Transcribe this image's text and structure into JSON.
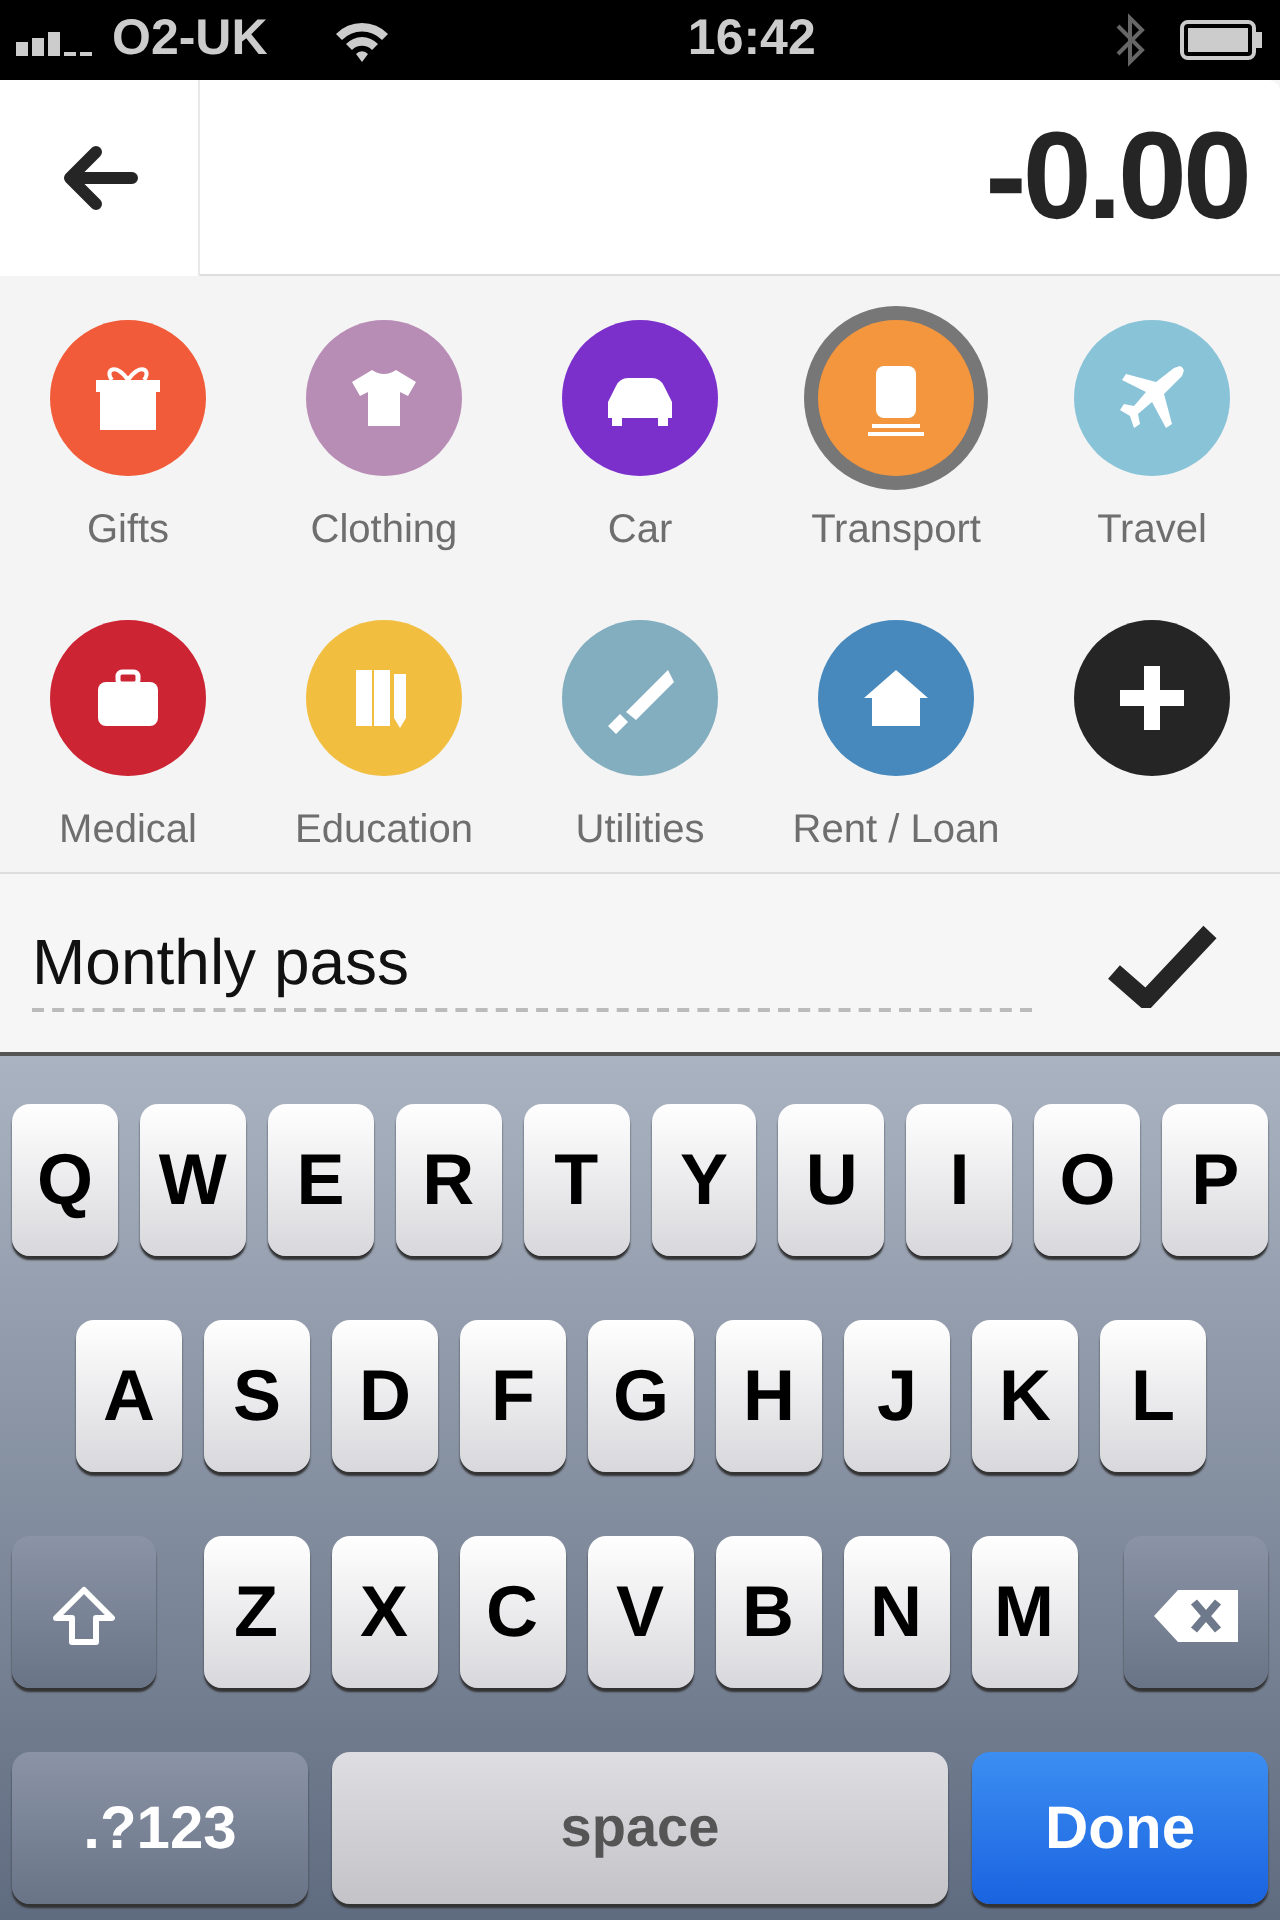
{
  "status_bar": {
    "carrier": "O2-UK",
    "time": "16:42"
  },
  "header": {
    "amount": "-0.00"
  },
  "categories": [
    {
      "kind": "category",
      "label": "Gifts",
      "color": "#f15b3a",
      "selected": false
    },
    {
      "kind": "category",
      "label": "Clothing",
      "color": "#b88db5",
      "selected": false
    },
    {
      "kind": "category",
      "label": "Car",
      "color": "#7b30cc",
      "selected": false
    },
    {
      "kind": "category",
      "label": "Transport",
      "color": "#f4963e",
      "selected": true
    },
    {
      "kind": "category",
      "label": "Travel",
      "color": "#89c3d8",
      "selected": false
    },
    {
      "kind": "category",
      "label": "Medical",
      "color": "#cd2434",
      "selected": false
    },
    {
      "kind": "category",
      "label": "Education",
      "color": "#f1be40",
      "selected": false
    },
    {
      "kind": "category",
      "label": "Utilities",
      "color": "#82aebf",
      "selected": false
    },
    {
      "kind": "category",
      "label": "Rent / Loan",
      "color": "#4789bc",
      "selected": false
    },
    {
      "kind": "add",
      "color": "#252525",
      "selected": false
    }
  ],
  "note": {
    "value": "Monthly pass"
  },
  "keyboard": {
    "rows": [
      {
        "keys": [
          {
            "kind": "letter",
            "label": "Q"
          },
          {
            "kind": "letter",
            "label": "W"
          },
          {
            "kind": "letter",
            "label": "E"
          },
          {
            "kind": "letter",
            "label": "R"
          },
          {
            "kind": "letter",
            "label": "T"
          },
          {
            "kind": "letter",
            "label": "Y"
          },
          {
            "kind": "letter",
            "label": "U"
          },
          {
            "kind": "letter",
            "label": "I"
          },
          {
            "kind": "letter",
            "label": "O"
          },
          {
            "kind": "letter",
            "label": "P"
          }
        ]
      },
      {
        "keys": [
          {
            "kind": "letter",
            "label": "A"
          },
          {
            "kind": "letter",
            "label": "S"
          },
          {
            "kind": "letter",
            "label": "D"
          },
          {
            "kind": "letter",
            "label": "F"
          },
          {
            "kind": "letter",
            "label": "G"
          },
          {
            "kind": "letter",
            "label": "H"
          },
          {
            "kind": "letter",
            "label": "J"
          },
          {
            "kind": "letter",
            "label": "K"
          },
          {
            "kind": "letter",
            "label": "L"
          }
        ]
      },
      {
        "keys": [
          {
            "kind": "shift"
          },
          {
            "kind": "letter",
            "label": "Z"
          },
          {
            "kind": "letter",
            "label": "X"
          },
          {
            "kind": "letter",
            "label": "C"
          },
          {
            "kind": "letter",
            "label": "V"
          },
          {
            "kind": "letter",
            "label": "B"
          },
          {
            "kind": "letter",
            "label": "N"
          },
          {
            "kind": "letter",
            "label": "M"
          },
          {
            "kind": "delete"
          }
        ]
      }
    ],
    "bottom_keys": [
      {
        "kind": "mode",
        "label": ".?123"
      },
      {
        "kind": "space",
        "label": "space"
      },
      {
        "kind": "done",
        "label": "Done"
      }
    ]
  }
}
